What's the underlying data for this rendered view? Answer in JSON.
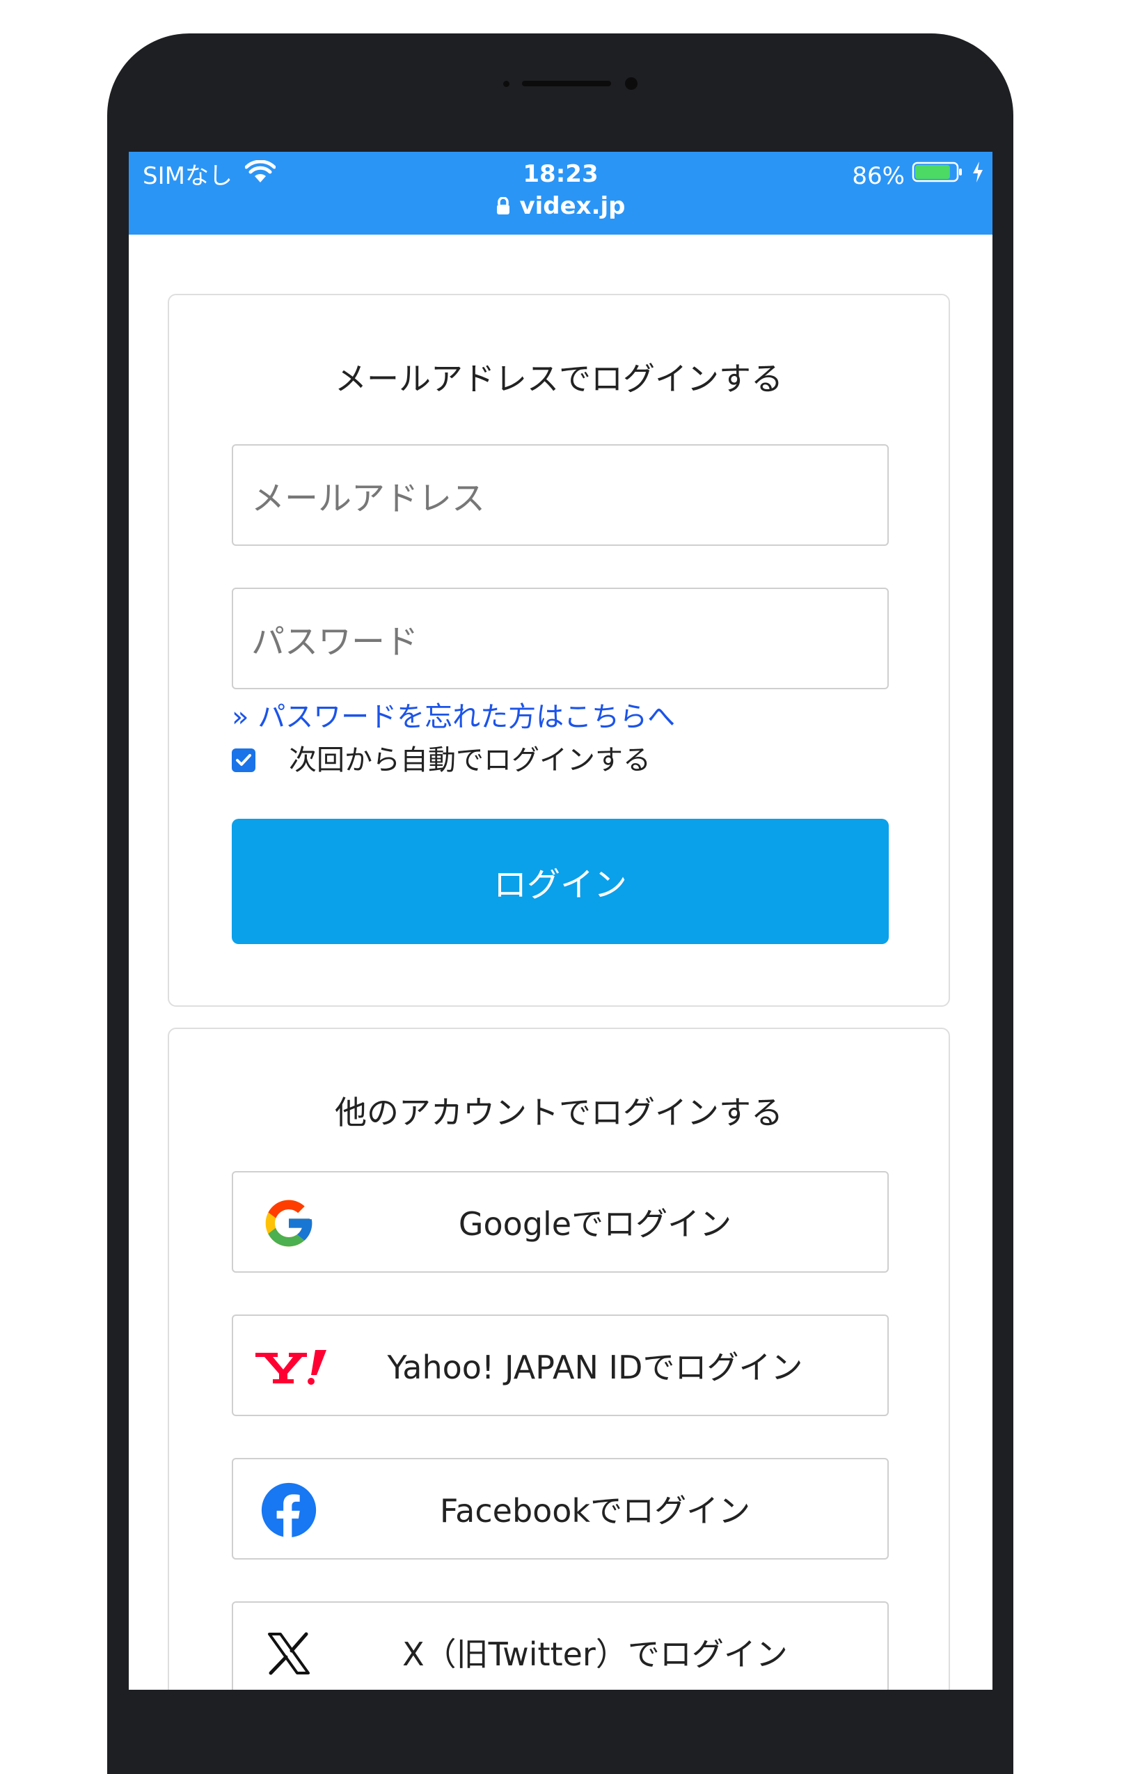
{
  "status_bar": {
    "carrier": "SIMなし",
    "time": "18:23",
    "url": "videx.jp",
    "battery_percent": "86%",
    "battery_level": 0.86,
    "background_color": "#2b95f6"
  },
  "email_login": {
    "title": "メールアドレスでログインする",
    "email_placeholder": "メールアドレス",
    "password_placeholder": "パスワード",
    "forgot_link": "» パスワードを忘れた方はこちらへ",
    "remember_label": "次回から自動でログインする",
    "remember_checked": true,
    "login_button": "ログイン",
    "login_button_color": "#0ba0ea"
  },
  "social_login": {
    "title": "他のアカウントでログインする",
    "buttons": [
      {
        "label": "Googleでログイン",
        "icon": "google-icon"
      },
      {
        "label": "Yahoo! JAPAN IDでログイン",
        "icon": "yahoo-japan-icon"
      },
      {
        "label": "Facebookでログイン",
        "icon": "facebook-icon"
      },
      {
        "label": "X（旧Twitter）でログイン",
        "icon": "x-icon"
      }
    ]
  }
}
